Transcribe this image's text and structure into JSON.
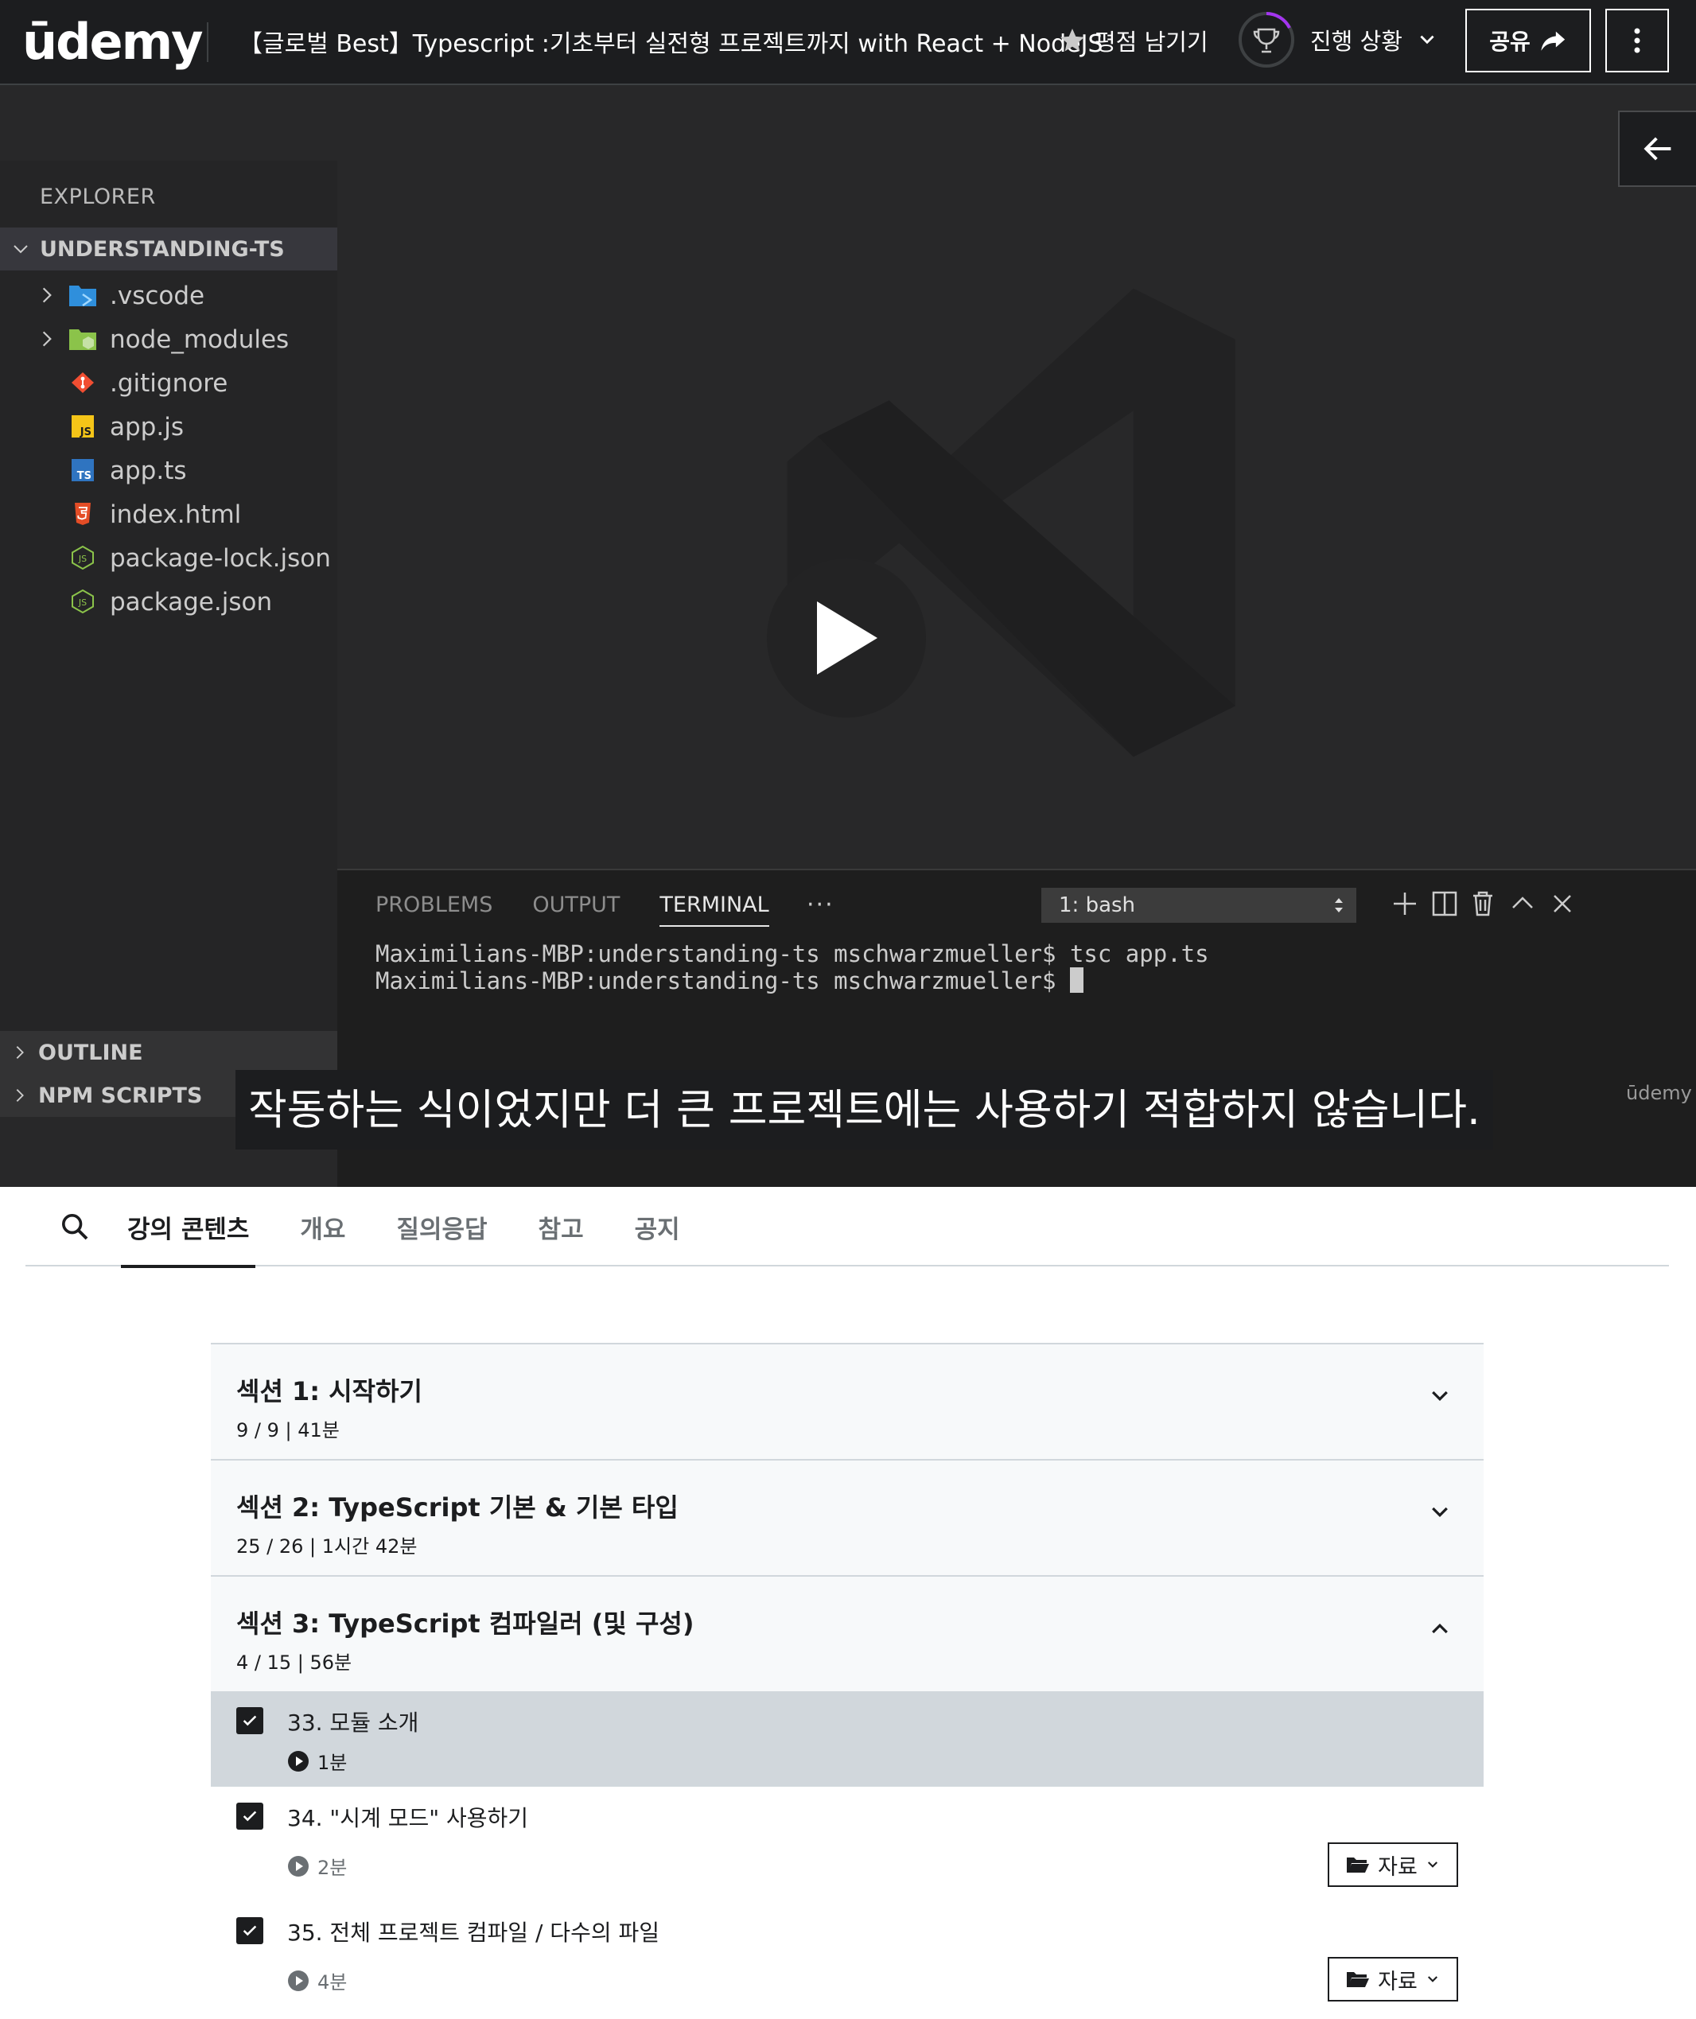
{
  "header": {
    "logo": "ūdemy",
    "course_title": "【글로벌 Best】Typescript :기초부터 실전형 프로젝트까지 with React + NodeJS",
    "rate_label": "평점 남기기",
    "progress_label": "진행 상황",
    "share_label": "공유"
  },
  "player": {
    "explorer": {
      "title": "EXPLORER",
      "root_folder": "UNDERSTANDING-TS",
      "items": [
        {
          "name": ".vscode",
          "type": "folder",
          "icon": "vscode-folder-icon"
        },
        {
          "name": "node_modules",
          "type": "folder",
          "icon": "node-folder-icon"
        },
        {
          "name": ".gitignore",
          "type": "file",
          "icon": "git-icon"
        },
        {
          "name": "app.js",
          "type": "file",
          "icon": "js-icon"
        },
        {
          "name": "app.ts",
          "type": "file",
          "icon": "ts-icon"
        },
        {
          "name": "index.html",
          "type": "file",
          "icon": "html5-icon"
        },
        {
          "name": "package-lock.json",
          "type": "file",
          "icon": "nodejs-icon"
        },
        {
          "name": "package.json",
          "type": "file",
          "icon": "nodejs-icon"
        }
      ],
      "outline": "OUTLINE",
      "npm_scripts": "NPM SCRIPTS"
    },
    "terminal": {
      "tabs": [
        "PROBLEMS",
        "OUTPUT",
        "TERMINAL"
      ],
      "active_tab": "TERMINAL",
      "dots": "···",
      "shell_select": "1: bash",
      "lines": [
        "Maximilians-MBP:understanding-ts mschwarzmueller$ tsc app.ts",
        "Maximilians-MBP:understanding-ts mschwarzmueller$ "
      ]
    },
    "caption": "작동하는 식이었지만 더 큰 프로젝트에는 사용하기 적합하지 않습니다.",
    "watermark": "ūdemy"
  },
  "tabs": {
    "items": [
      "강의 콘텐츠",
      "개요",
      "질의응답",
      "참고",
      "공지"
    ],
    "active": "강의 콘텐츠"
  },
  "sections": [
    {
      "title": "섹션 1: 시작하기",
      "meta": "9 / 9 | 41분",
      "expanded": false
    },
    {
      "title": "섹션 2: TypeScript 기본 & 기본 타입",
      "meta": "25 / 26 | 1시간 42분",
      "expanded": false
    },
    {
      "title": "섹션 3: TypeScript 컴파일러 (및 구성)",
      "meta": "4 / 15 | 56분",
      "expanded": true
    }
  ],
  "lessons": [
    {
      "title": "33. 모듈 소개",
      "duration": "1분",
      "completed": true,
      "current": true
    },
    {
      "title": "34. \"시계 모드\" 사용하기",
      "duration": "2분",
      "completed": true,
      "current": false,
      "resources_label": "자료"
    },
    {
      "title": "35. 전체 프로젝트 컴파일 / 다수의 파일",
      "duration": "4분",
      "completed": true,
      "current": false,
      "resources_label": "자료"
    }
  ],
  "colors": {
    "header_bg": "#1c1d1f",
    "player_bg": "#282829",
    "sidebar_bg": "#252526",
    "terminal_bg": "#1e1e1e",
    "section_bg": "#f7f9fa",
    "current_lesson_bg": "#d1d7dc",
    "progress_accent": "#a435f0"
  }
}
